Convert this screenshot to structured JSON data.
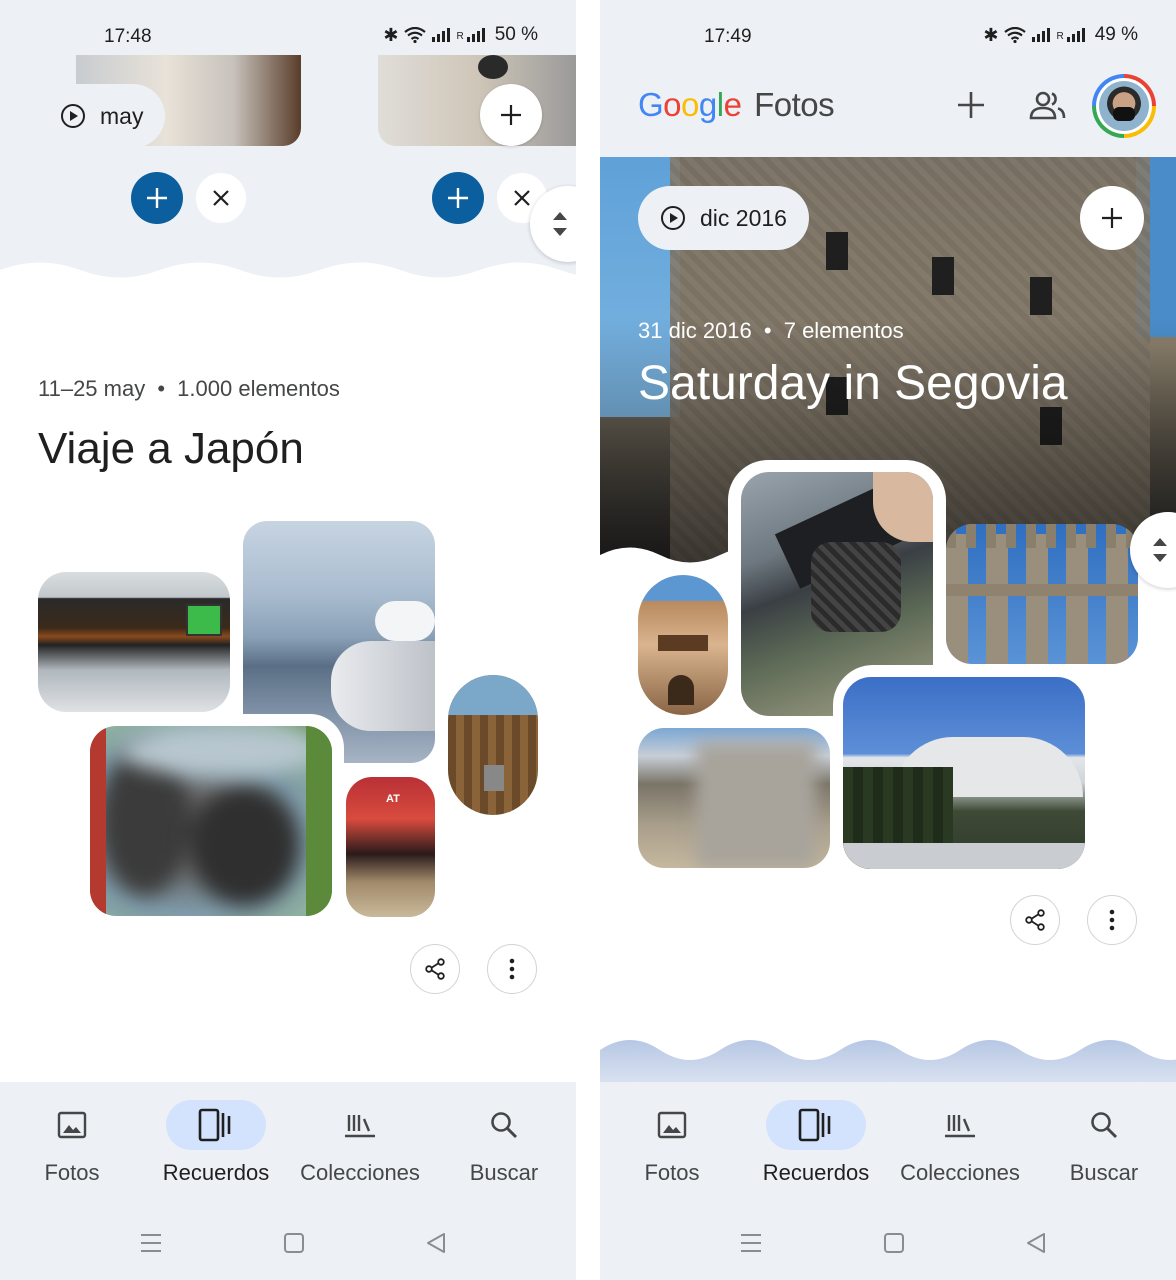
{
  "left": {
    "status": {
      "time": "17:48",
      "battery": "50 %"
    },
    "top_chip": {
      "label": "may"
    },
    "memory": {
      "meta": "11–25 may",
      "count": "1.000 elementos",
      "title": "Viaje a Japón"
    }
  },
  "right": {
    "status": {
      "time": "17:49",
      "battery": "49 %"
    },
    "app": {
      "logo_google": "Google",
      "logo_fotos": "Fotos"
    },
    "memory": {
      "chip": "dic 2016",
      "meta": "31 dic 2016",
      "count": "7 elementos",
      "title": "Saturday in Segovia"
    }
  },
  "nav": {
    "items": [
      "Fotos",
      "Recuerdos",
      "Colecciones",
      "Buscar"
    ],
    "active": "Recuerdos"
  },
  "colors": {
    "accent": "#0b5f9e",
    "nav_bg": "#edf1f6",
    "nav_active": "#d3e3fd",
    "google_blue": "#4285f4",
    "google_red": "#ea4335",
    "google_yellow": "#fbbc05",
    "google_green": "#34a853"
  },
  "icons": [
    "play-icon",
    "plus-icon",
    "close-icon",
    "sort-icon",
    "share-icon",
    "more-vert-icon",
    "photo-icon",
    "memories-icon",
    "collections-icon",
    "search-icon",
    "people-icon",
    "menu-icon",
    "home-icon",
    "back-icon"
  ]
}
